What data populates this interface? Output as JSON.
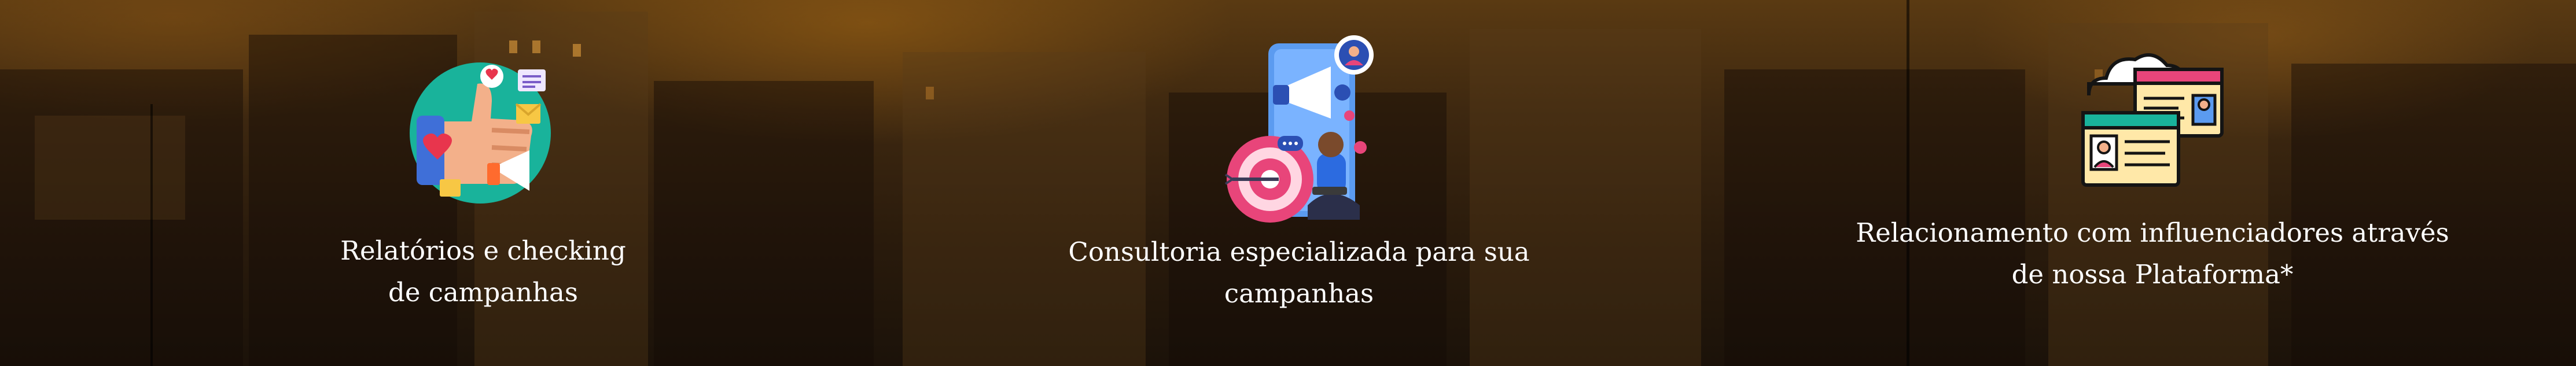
{
  "features": [
    {
      "id": "reports",
      "caption_line1": "Relatórios e checking",
      "caption_line2": "de campanhas",
      "icon": "thumbs-up-marketing-icon"
    },
    {
      "id": "consulting",
      "caption_line1": "Consultoria especializada para sua",
      "caption_line2": "campanhas",
      "icon": "megaphone-target-consultant-icon"
    },
    {
      "id": "influencers",
      "caption_line1": "Relacionamento com influenciadores através",
      "caption_line2": "de nossa Plataforma*",
      "icon": "cloud-profile-windows-icon"
    }
  ],
  "colors": {
    "overlay": "#3e2810",
    "accent_teal": "#19b39b",
    "accent_pink": "#e8457a",
    "text": "#ffffff"
  }
}
